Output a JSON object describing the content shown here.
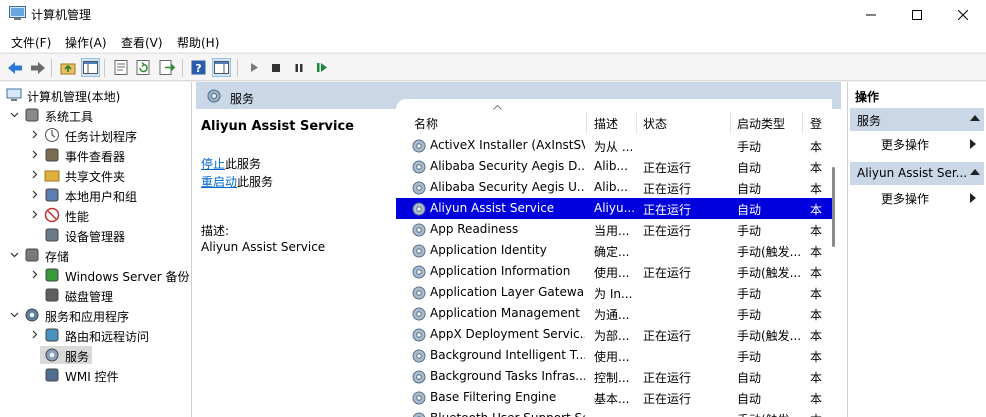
{
  "window": {
    "title": "计算机管理"
  },
  "menu": [
    "文件(F)",
    "操作(A)",
    "查看(V)",
    "帮助(H)"
  ],
  "tree": [
    {
      "label": "计算机管理(本地)",
      "icon": "computer-management-icon",
      "chevron": ""
    },
    {
      "label": "系统工具",
      "icon": "system-tools-icon",
      "chevron": "down"
    },
    {
      "label": "任务计划程序",
      "icon": "task-scheduler-icon",
      "chevron": "right"
    },
    {
      "label": "事件查看器",
      "icon": "event-viewer-icon",
      "chevron": "right"
    },
    {
      "label": "共享文件夹",
      "icon": "shared-folders-icon",
      "chevron": "right"
    },
    {
      "label": "本地用户和组",
      "icon": "users-icon",
      "chevron": "right"
    },
    {
      "label": "性能",
      "icon": "performance-icon",
      "chevron": "right"
    },
    {
      "label": "设备管理器",
      "icon": "device-manager-icon",
      "chevron": ""
    },
    {
      "label": "存储",
      "icon": "storage-icon",
      "chevron": "down"
    },
    {
      "label": "Windows Server 备份",
      "icon": "backup-icon",
      "chevron": "right"
    },
    {
      "label": "磁盘管理",
      "icon": "disk-management-icon",
      "chevron": ""
    },
    {
      "label": "服务和应用程序",
      "icon": "services-apps-icon",
      "chevron": "down"
    },
    {
      "label": "路由和远程访问",
      "icon": "routing-icon",
      "chevron": "right"
    },
    {
      "label": "服务",
      "icon": "services-icon",
      "chevron": "",
      "selected": true
    },
    {
      "label": "WMI 控件",
      "icon": "wmi-icon",
      "chevron": ""
    }
  ],
  "services_header": "服务",
  "description_pane": {
    "title": "Aliyun Assist Service",
    "stop_link": "停止",
    "stop_suffix": "此服务",
    "restart_link": "重启动",
    "restart_suffix": "此服务",
    "desc_label": "描述:",
    "desc_value": "Aliyun Assist Service"
  },
  "columns": [
    "名称",
    "描述",
    "状态",
    "启动类型",
    "登"
  ],
  "rows": [
    {
      "name": "ActiveX Installer (AxInstSV)",
      "desc": "为从 ...",
      "status": "",
      "startup": "手动",
      "logon": "本"
    },
    {
      "name": "Alibaba Security Aegis D...",
      "desc": "Alib...",
      "status": "正在运行",
      "startup": "自动",
      "logon": "本"
    },
    {
      "name": "Alibaba Security Aegis U...",
      "desc": "Alib...",
      "status": "正在运行",
      "startup": "自动",
      "logon": "本"
    },
    {
      "name": "Aliyun Assist Service",
      "desc": "Aliyu...",
      "status": "正在运行",
      "startup": "自动",
      "logon": "本",
      "selected": true
    },
    {
      "name": "App Readiness",
      "desc": "当用...",
      "status": "正在运行",
      "startup": "手动",
      "logon": "本"
    },
    {
      "name": "Application Identity",
      "desc": "确定...",
      "status": "",
      "startup": "手动(触发...",
      "logon": "本"
    },
    {
      "name": "Application Information",
      "desc": "使用...",
      "status": "正在运行",
      "startup": "手动(触发...",
      "logon": "本"
    },
    {
      "name": "Application Layer Gatewa...",
      "desc": "为 In...",
      "status": "",
      "startup": "手动",
      "logon": "本"
    },
    {
      "name": "Application Management",
      "desc": "为通...",
      "status": "",
      "startup": "手动",
      "logon": "本"
    },
    {
      "name": "AppX Deployment Servic...",
      "desc": "为部...",
      "status": "正在运行",
      "startup": "手动(触发...",
      "logon": "本"
    },
    {
      "name": "Background Intelligent T...",
      "desc": "使用...",
      "status": "",
      "startup": "手动",
      "logon": "本"
    },
    {
      "name": "Background Tasks Infras...",
      "desc": "控制...",
      "status": "正在运行",
      "startup": "自动",
      "logon": "本"
    },
    {
      "name": "Base Filtering Engine",
      "desc": "基本...",
      "status": "正在运行",
      "startup": "自动",
      "logon": "本"
    },
    {
      "name": "Bluetooth User Support Se...",
      "desc": "...",
      "status": "",
      "startup": "手动(触发...",
      "logon": "本"
    }
  ],
  "actions": {
    "heading": "操作",
    "group1": "服务",
    "group1_item": "更多操作",
    "group2": "Aliyun Assist Ser...",
    "group2_item": "更多操作"
  },
  "colors": {
    "selection": "#0000dd",
    "header_band": "#c9d7e6",
    "link": "#0066cc"
  }
}
